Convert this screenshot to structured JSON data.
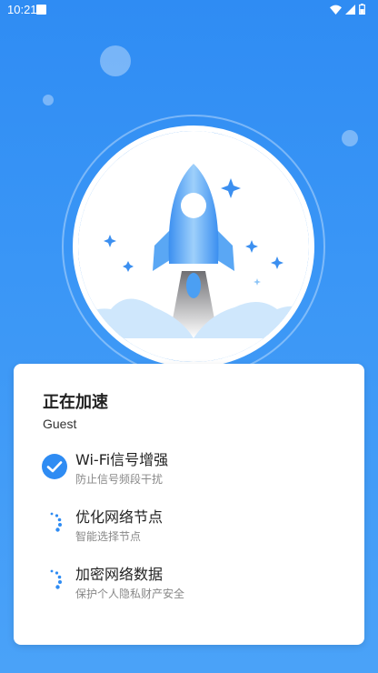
{
  "status_bar": {
    "time": "10:21",
    "icons": [
      "notification-square-icon",
      "wifi-icon",
      "signal-icon",
      "battery-icon"
    ]
  },
  "colors": {
    "background_top": "#2f8cf3",
    "background_bottom": "#4aa2f8",
    "accent": "#2f8cf3",
    "card": "#ffffff"
  },
  "hero": {
    "icon": "rocket-icon"
  },
  "card": {
    "title": "正在加速",
    "user": "Guest",
    "tasks": [
      {
        "title": "Wi-Fi信号增强",
        "subtitle": "防止信号频段干扰",
        "status": "done",
        "icon": "check-circle-icon"
      },
      {
        "title": "优化网络节点",
        "subtitle": "智能选择节点",
        "status": "loading",
        "icon": "loading-spinner-icon"
      },
      {
        "title": "加密网络数据",
        "subtitle": "保护个人隐私财产安全",
        "status": "loading",
        "icon": "loading-spinner-icon"
      }
    ]
  }
}
